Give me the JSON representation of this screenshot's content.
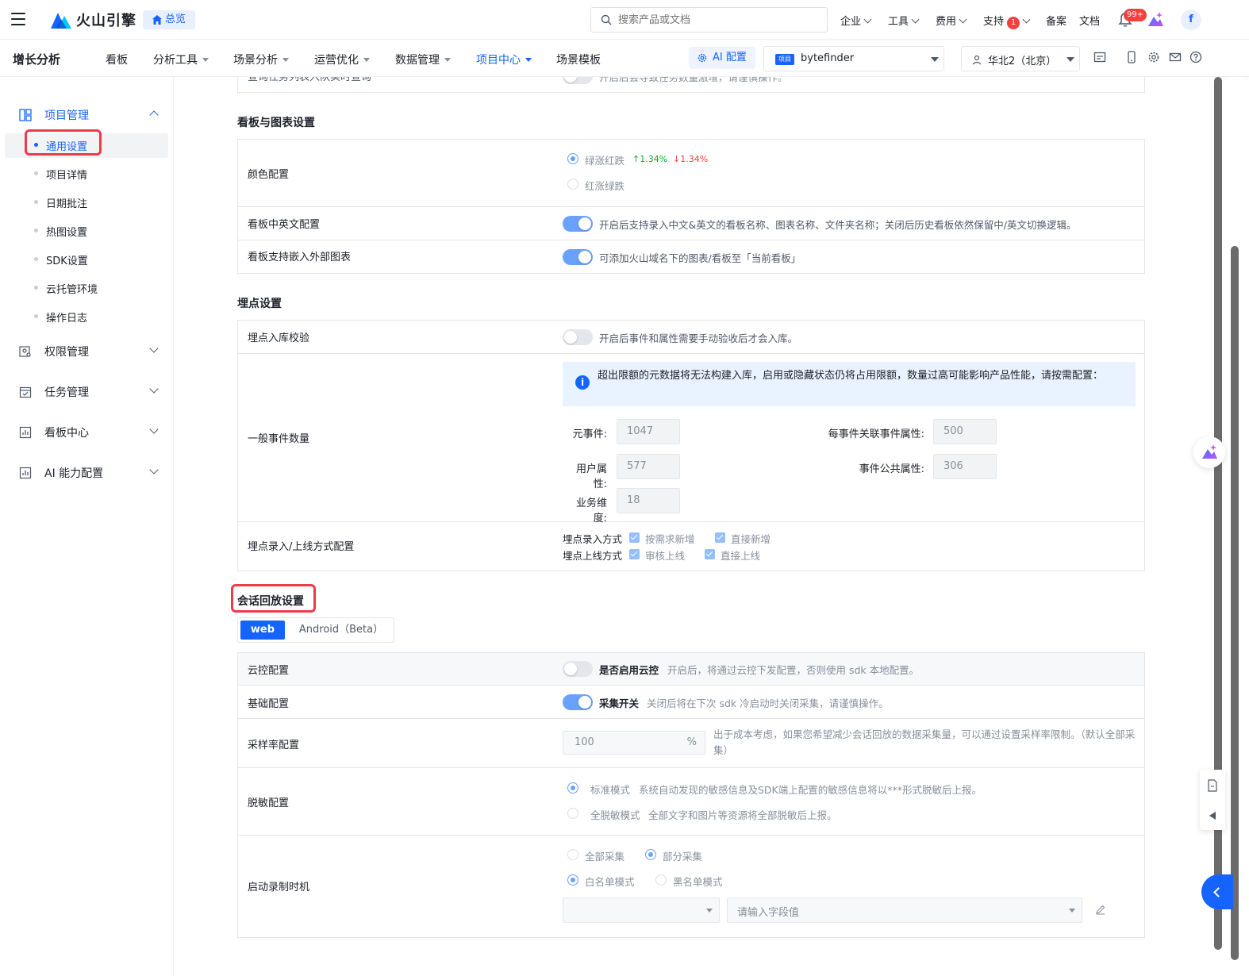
{
  "topbar": {
    "brand": "火山引擎",
    "home_chip": "总览",
    "search_placeholder": "搜索产品或文档",
    "menus": [
      "企业",
      "工具",
      "费用",
      "支持"
    ],
    "support_badge": "1",
    "links": [
      "备案",
      "文档"
    ],
    "bell_badge": "99+",
    "avatar_letter": "f"
  },
  "nav": {
    "product": "增长分析",
    "items": [
      "看板",
      "分析工具",
      "场景分析",
      "运营优化",
      "数据管理",
      "项目中心",
      "场景模板"
    ],
    "ai_button": "AI 配置",
    "project_tag": "项目",
    "project_name": "bytefinder",
    "region": "华北2（北京）"
  },
  "sidebar": {
    "group_project": "项目管理",
    "sub_items": [
      "通用设置",
      "项目详情",
      "日期批注",
      "热图设置",
      "SDK设置",
      "云托管环境",
      "操作日志"
    ],
    "groups": [
      "权限管理",
      "任务管理",
      "看板中心",
      "AI 能力配置"
    ]
  },
  "main": {
    "top_cut_label": "查询任务列表入队实时查询",
    "top_cut_desc": "开启后会导致任务数量激增，请谨慎操作。",
    "board": {
      "title": "看板与图表设置",
      "color_label": "颜色配置",
      "color_opt1": "绿涨红跌",
      "up_value": "↑1.34%",
      "down_value": "↓1.34%",
      "color_opt2": "红涨绿跌",
      "bilingual_label": "看板中英文配置",
      "bilingual_desc": "开启后支持录入中文&英文的看板名称、图表名称、文件夹名称；关闭后历史看板依然保留中/英文切换逻辑。",
      "embed_label": "看板支持嵌入外部图表",
      "embed_desc": "可添加火山域名下的图表/看板至「当前看板」"
    },
    "tracking": {
      "title": "埋点设置",
      "verify_label": "埋点入库校验",
      "verify_desc": "开启后事件和属性需要手动验收后才会入库。",
      "count_label": "一般事件数量",
      "info": "超出限额的元数据将无法构建入库，启用或隐藏状态仍将占用限额，数量过高可能影响产品性能，请按需配置：",
      "meta_event_label": "元事件:",
      "meta_event_value": "1047",
      "per_event_label": "每事件关联事件属性:",
      "per_event_value": "500",
      "user_attr_label": "用户属性:",
      "user_attr_value": "577",
      "common_attr_label": "事件公共属性:",
      "common_attr_value": "306",
      "biz_dim_label": "业务维度:",
      "biz_dim_value": "18",
      "entry_label": "埋点录入/上线方式配置",
      "entry_mode": "埋点录入方式",
      "entry_opt1": "按需求新增",
      "entry_opt2": "直接新增",
      "online_mode": "埋点上线方式",
      "online_opt1": "审核上线",
      "online_opt2": "直接上线"
    },
    "replay": {
      "title": "会话回放设置",
      "tab_web": "web",
      "tab_android": "Android（Beta）",
      "cloud_label": "云控配置",
      "cloud_title": "是否启用云控",
      "cloud_desc": "开启后，将通过云控下发配置，否则使用 sdk 本地配置。",
      "basic_label": "基础配置",
      "basic_title": "采集开关",
      "basic_desc": "关闭后将在下次 sdk 冷启动时关闭采集，请谨慎操作。",
      "sample_label": "采样率配置",
      "sample_value": "100",
      "sample_unit": "%",
      "sample_desc": "出于成本考虑，如果您希望减少会话回放的数据采集量，可以通过设置采样率限制。（默认全部采集）",
      "mask_label": "脱敏配置",
      "mask_opt1_title": "标准模式",
      "mask_opt1_desc": "系统自动发现的敏感信息及SDK端上配置的敏感信息将以***形式脱敏后上报。",
      "mask_opt2_title": "全脱敏模式",
      "mask_opt2_desc": "全部文字和图片等资源将全部脱敏后上报。",
      "start_label": "启动录制时机",
      "start_opt1": "全部采集",
      "start_opt2": "部分采集",
      "list_opt1": "白名单模式",
      "list_opt2": "黑名单模式",
      "field_placeholder": "请输入字段值"
    }
  },
  "colors": {
    "primary": "#1664ff",
    "up_green": "#00b42a",
    "down_red": "#f53f3f",
    "highlight_box": "#ee3a4a"
  }
}
